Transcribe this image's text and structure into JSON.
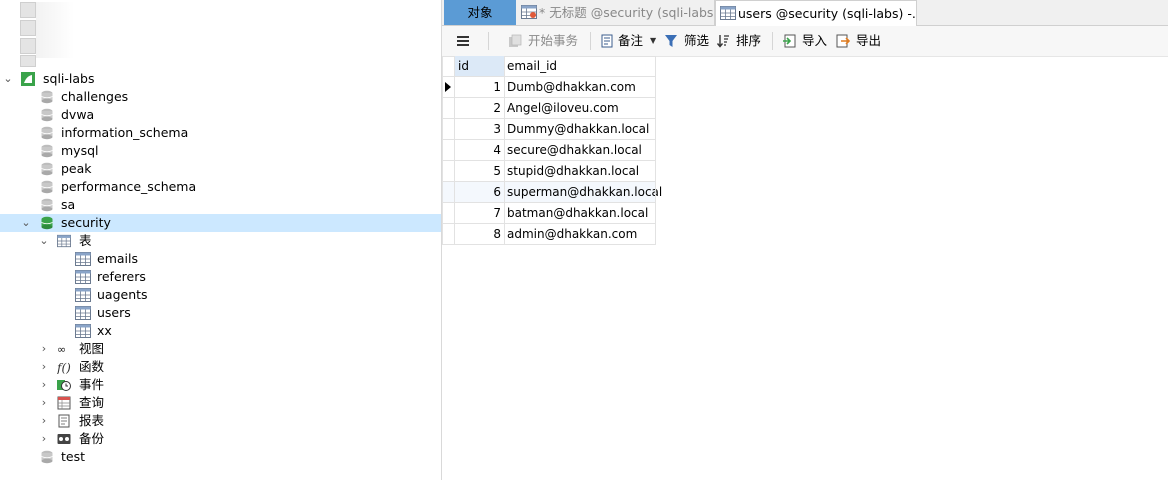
{
  "tree": {
    "connection": "sqli-labs",
    "databases_before": [
      "challenges",
      "dvwa",
      "information_schema",
      "mysql",
      "peak",
      "performance_schema",
      "sa"
    ],
    "selected_db": "security",
    "tables_group": "表",
    "tables": [
      "emails",
      "referers",
      "uagents",
      "users",
      "xx"
    ],
    "groups": [
      "视图",
      "函数",
      "事件",
      "查询",
      "报表",
      "备份"
    ],
    "databases_after": [
      "test"
    ]
  },
  "tabs": {
    "objects": "对象",
    "untitled": "* 无标题 @security (sqli-labs...",
    "users": "users @security (sqli-labs) -..."
  },
  "toolbar": {
    "begin_transaction": "开始事务",
    "memo": "备注",
    "filter": "筛选",
    "sort": "排序",
    "import": "导入",
    "export": "导出"
  },
  "grid": {
    "columns": [
      "id",
      "email_id"
    ],
    "rows": [
      {
        "id": "1",
        "email_id": "Dumb@dhakkan.com"
      },
      {
        "id": "2",
        "email_id": "Angel@iloveu.com"
      },
      {
        "id": "3",
        "email_id": "Dummy@dhakkan.local"
      },
      {
        "id": "4",
        "email_id": "secure@dhakkan.local"
      },
      {
        "id": "5",
        "email_id": "stupid@dhakkan.local"
      },
      {
        "id": "6",
        "email_id": "superman@dhakkan.local"
      },
      {
        "id": "7",
        "email_id": "batman@dhakkan.local"
      },
      {
        "id": "8",
        "email_id": "admin@dhakkan.com"
      }
    ]
  },
  "colors": {
    "selection": "#cce8ff",
    "active_tab": "#5b9bd5",
    "db_green": "#3aa34a"
  }
}
